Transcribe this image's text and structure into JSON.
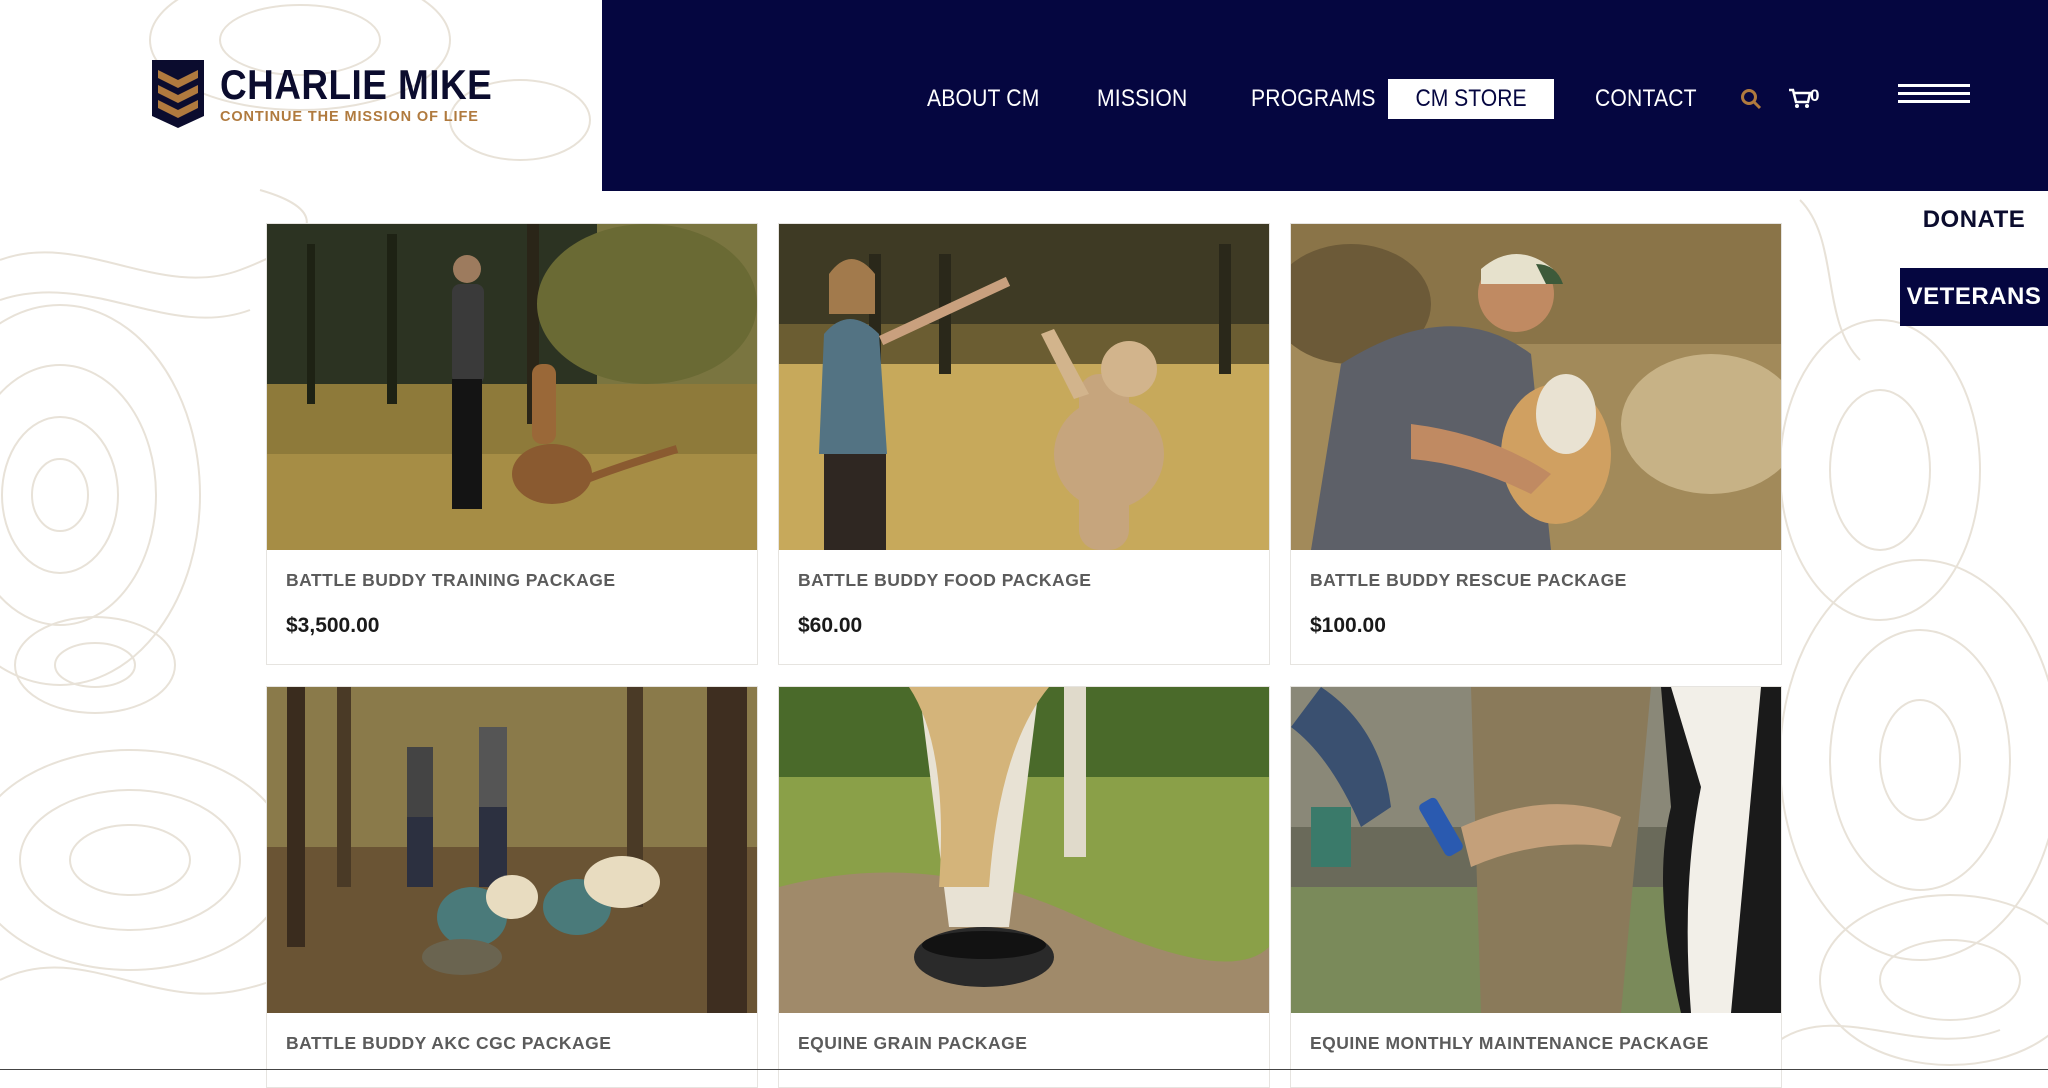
{
  "brand": {
    "name": "CHARLIE MIKE",
    "tagline": "CONTINUE THE MISSION OF LIFE",
    "colors": {
      "navy": "#050640",
      "gold": "#b07a3e"
    }
  },
  "nav": {
    "items": [
      {
        "label": "ABOUT CM"
      },
      {
        "label": "MISSION"
      },
      {
        "label": "PROGRAMS"
      },
      {
        "label": "CM STORE",
        "active": true
      },
      {
        "label": "CONTACT"
      }
    ],
    "search_icon": "search-icon",
    "cart_icon": "cart-icon",
    "cart_count": "0",
    "menu_icon": "hamburger-icon"
  },
  "side_actions": {
    "donate": "DONATE",
    "veterans": "VETERANS"
  },
  "products": [
    {
      "name": "BATTLE BUDDY TRAINING PACKAGE",
      "price": "$3,500.00"
    },
    {
      "name": "BATTLE BUDDY FOOD PACKAGE",
      "price": "$60.00"
    },
    {
      "name": "BATTLE BUDDY RESCUE PACKAGE",
      "price": "$100.00"
    },
    {
      "name": "BATTLE BUDDY AKC CGC PACKAGE",
      "price": ""
    },
    {
      "name": "EQUINE GRAIN PACKAGE",
      "price": ""
    },
    {
      "name": "EQUINE MONTHLY MAINTENANCE PACKAGE",
      "price": ""
    }
  ]
}
